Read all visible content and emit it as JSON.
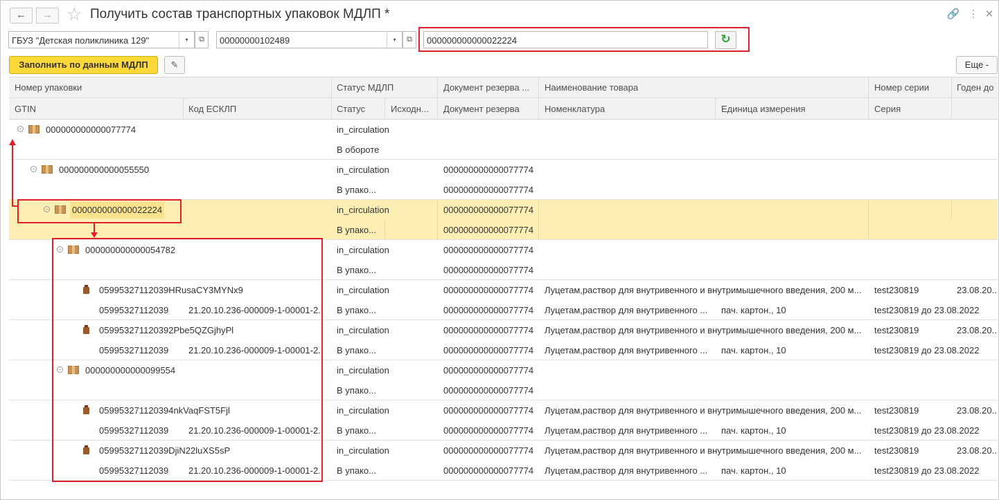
{
  "window": {
    "title": "Получить состав транспортных упаковок МДЛП *",
    "back_icon": "←",
    "forward_icon": "→",
    "star_icon": "☆",
    "link_icon": "🔗",
    "menu_icon": "⋮",
    "close_icon": "✕"
  },
  "filters": {
    "organization": "ГБУЗ \"Детская поликлиника 129\"",
    "storage": "00000000102489",
    "package_code": "000000000000022224",
    "dropdown_icon": "▾",
    "open_icon": "⧉",
    "refresh_icon": "↻"
  },
  "toolbar": {
    "fill_button": "Заполнить по данным МДЛП",
    "scan_icon": "✎",
    "more_button": "Еще -"
  },
  "table": {
    "headers_top": {
      "package": "Номер упаковки",
      "status_mdlp": "Статус МДЛП",
      "reserve_doc": "Документ резерва ...",
      "product": "Наименование товара",
      "series_no": "Номер серии",
      "valid_to": "Годен до"
    },
    "headers_bottom": {
      "gtin": "GTIN",
      "esklp": "Код ЕСКЛП",
      "status": "Статус",
      "source": "Исходн...",
      "reserve_doc": "Документ резерва",
      "nomenclature": "Номенклатура",
      "unit": "Единица измерения",
      "series": "Серия"
    },
    "rows": [
      {
        "code": "000000000000077774",
        "status": "in_circulation",
        "status2": "В обороте",
        "doc1": "",
        "doc2": ""
      },
      {
        "code": "000000000000055550",
        "status": "in_circulation",
        "status2": "В упако...",
        "doc1": "000000000000077774",
        "doc2": "000000000000077774"
      },
      {
        "code": "000000000000022224",
        "status": "in_circulation",
        "status2": "В упако...",
        "doc1": "000000000000077774",
        "doc2": "000000000000077774"
      },
      {
        "code": "000000000000054782",
        "status": "in_circulation",
        "status2": "В упако...",
        "doc1": "000000000000077774",
        "doc2": "000000000000077774"
      },
      {
        "code": "05995327112039HRusaCY3MYNx9",
        "gtin": "05995327112039",
        "esklp": "21.20.10.236-000009-1-00001-2...",
        "status": "in_circulation",
        "status2": "В упако...",
        "doc1": "000000000000077774",
        "doc2": "000000000000077774",
        "product": "Луцетам,раствор для внутривенного и внутримышечного введения, 200 м...",
        "nomenclature": "Луцетам,раствор для внутривенного ...",
        "unit": "пач. картон., 10",
        "series_no": "test230819",
        "series": "test230819 до 23.08.2022",
        "valid": "23.08.20..."
      },
      {
        "code": "059953271120392Pbe5QZGjhyPl",
        "gtin": "05995327112039",
        "esklp": "21.20.10.236-000009-1-00001-2...",
        "status": "in_circulation",
        "status2": "В упако...",
        "doc1": "000000000000077774",
        "doc2": "000000000000077774",
        "product": "Луцетам,раствор для внутривенного и внутримышечного введения, 200 м...",
        "nomenclature": "Луцетам,раствор для внутривенного ...",
        "unit": "пач. картон., 10",
        "series_no": "test230819",
        "series": "test230819 до 23.08.2022",
        "valid": "23.08.20..."
      },
      {
        "code": "000000000000099554",
        "status": "in_circulation",
        "status2": "В упако...",
        "doc1": "000000000000077774",
        "doc2": "000000000000077774"
      },
      {
        "code": "059953271120394nkVaqFST5Fjl",
        "gtin": "05995327112039",
        "esklp": "21.20.10.236-000009-1-00001-2...",
        "status": "in_circulation",
        "status2": "В упако...",
        "doc1": "000000000000077774",
        "doc2": "000000000000077774",
        "product": "Луцетам,раствор для внутривенного и внутримышечного введения, 200 м...",
        "nomenclature": "Луцетам,раствор для внутривенного ...",
        "unit": "пач. картон., 10",
        "series_no": "test230819",
        "series": "test230819 до 23.08.2022",
        "valid": "23.08.20..."
      },
      {
        "code": "05995327112039DjiN22luXS5sP",
        "gtin": "05995327112039",
        "esklp": "21.20.10.236-000009-1-00001-2...",
        "status": "in_circulation",
        "status2": "В упако...",
        "doc1": "000000000000077774",
        "doc2": "000000000000077774",
        "product": "Луцетам,раствор для внутривенного и внутримышечного введения, 200 м...",
        "nomenclature": "Луцетам,раствор для внутривенного ...",
        "unit": "пач. картон., 10",
        "series_no": "test230819",
        "series": "test230819 до 23.08.2022",
        "valid": "23.08.20..."
      }
    ]
  },
  "colors": {
    "selected_row": "#fdeeb4",
    "selected_code": "#fbe28e",
    "accent_button": "#ffd83a",
    "annotation": "#e0202b"
  }
}
